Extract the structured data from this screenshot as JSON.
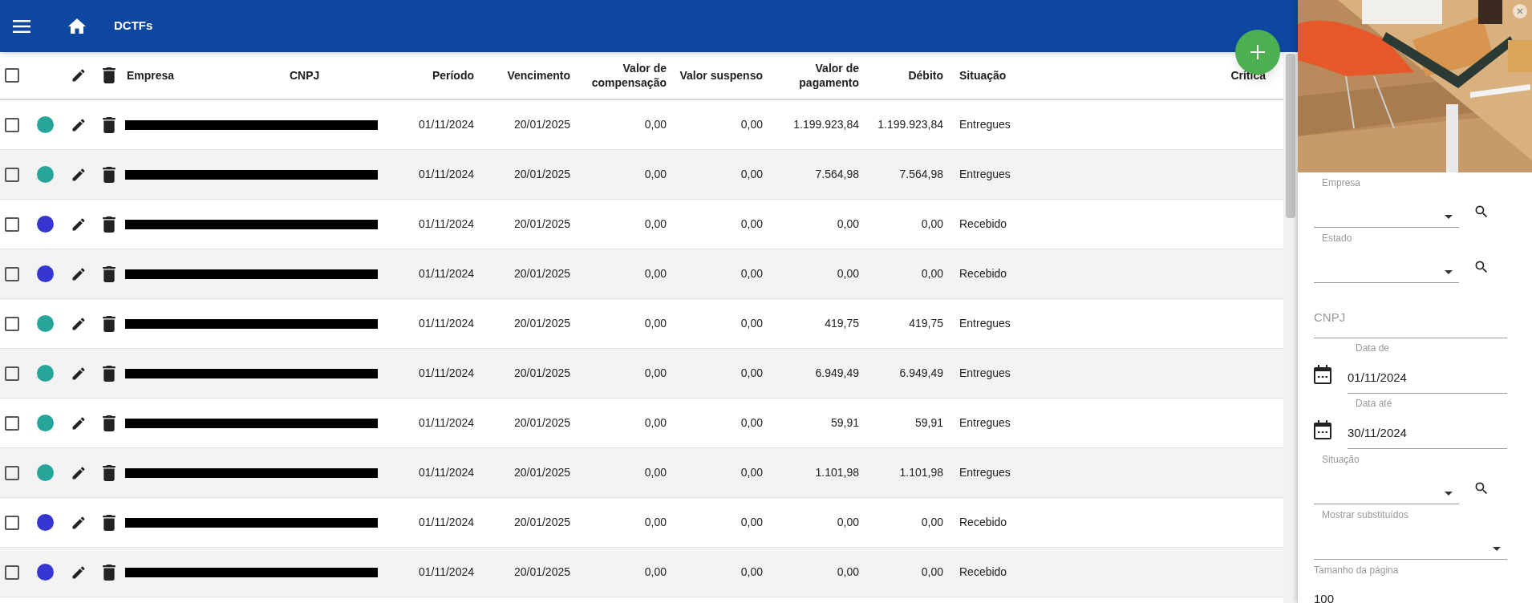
{
  "app_bar": {
    "title": "DCTFs"
  },
  "table": {
    "select_all": {
      "checked": false
    },
    "columns": [
      "Empresa",
      "CNPJ",
      "Período",
      "Vencimento",
      "Valor de compensação",
      "Valor suspenso",
      "Valor de pagamento",
      "Débito",
      "Situação",
      "Crítica"
    ],
    "rows": [
      {
        "checked": false,
        "color": "#26a69a",
        "redacted": true,
        "periodo": "01/11/2024",
        "vencimento": "20/01/2025",
        "compensacao": "0,00",
        "suspenso": "0,00",
        "pagamento": "1.199.923,84",
        "debito": "1.199.923,84",
        "situacao": "Entregues"
      },
      {
        "checked": false,
        "color": "#26a69a",
        "redacted": true,
        "periodo": "01/11/2024",
        "vencimento": "20/01/2025",
        "compensacao": "0,00",
        "suspenso": "0,00",
        "pagamento": "7.564,98",
        "debito": "7.564,98",
        "situacao": "Entregues"
      },
      {
        "checked": false,
        "color": "#3535cf",
        "redacted": true,
        "periodo": "01/11/2024",
        "vencimento": "20/01/2025",
        "compensacao": "0,00",
        "suspenso": "0,00",
        "pagamento": "0,00",
        "debito": "0,00",
        "situacao": "Recebido"
      },
      {
        "checked": false,
        "color": "#3535cf",
        "redacted": true,
        "periodo": "01/11/2024",
        "vencimento": "20/01/2025",
        "compensacao": "0,00",
        "suspenso": "0,00",
        "pagamento": "0,00",
        "debito": "0,00",
        "situacao": "Recebido"
      },
      {
        "checked": false,
        "color": "#26a69a",
        "redacted": true,
        "periodo": "01/11/2024",
        "vencimento": "20/01/2025",
        "compensacao": "0,00",
        "suspenso": "0,00",
        "pagamento": "419,75",
        "debito": "419,75",
        "situacao": "Entregues"
      },
      {
        "checked": false,
        "color": "#26a69a",
        "redacted": true,
        "periodo": "01/11/2024",
        "vencimento": "20/01/2025",
        "compensacao": "0,00",
        "suspenso": "0,00",
        "pagamento": "6.949,49",
        "debito": "6.949,49",
        "situacao": "Entregues"
      },
      {
        "checked": false,
        "color": "#26a69a",
        "redacted": true,
        "periodo": "01/11/2024",
        "vencimento": "20/01/2025",
        "compensacao": "0,00",
        "suspenso": "0,00",
        "pagamento": "59,91",
        "debito": "59,91",
        "situacao": "Entregues"
      },
      {
        "checked": false,
        "color": "#26a69a",
        "redacted": true,
        "periodo": "01/11/2024",
        "vencimento": "20/01/2025",
        "compensacao": "0,00",
        "suspenso": "0,00",
        "pagamento": "1.101,98",
        "debito": "1.101,98",
        "situacao": "Entregues"
      },
      {
        "checked": false,
        "color": "#3535cf",
        "redacted": true,
        "periodo": "01/11/2024",
        "vencimento": "20/01/2025",
        "compensacao": "0,00",
        "suspenso": "0,00",
        "pagamento": "0,00",
        "debito": "0,00",
        "situacao": "Recebido"
      },
      {
        "checked": false,
        "color": "#3535cf",
        "redacted": true,
        "periodo": "01/11/2024",
        "vencimento": "20/01/2025",
        "compensacao": "0,00",
        "suspenso": "0,00",
        "pagamento": "0,00",
        "debito": "0,00",
        "situacao": "Recebido"
      }
    ]
  },
  "filter_panel": {
    "fields": [
      {
        "kind": "select",
        "label": "Empresa",
        "search": true
      },
      {
        "kind": "select",
        "label": "Estado",
        "search": true
      },
      {
        "kind": "text",
        "placeholder": "CNPJ"
      },
      {
        "kind": "date",
        "label": "Data de",
        "value": "01/11/2024"
      },
      {
        "kind": "date",
        "label": "Data até",
        "value": "30/11/2024"
      },
      {
        "kind": "select",
        "label": "Situação",
        "search": true
      },
      {
        "kind": "select",
        "label": "Mostrar substituídos",
        "search": false
      },
      {
        "kind": "text",
        "label": "Tamanho da página",
        "value": "100"
      }
    ]
  }
}
